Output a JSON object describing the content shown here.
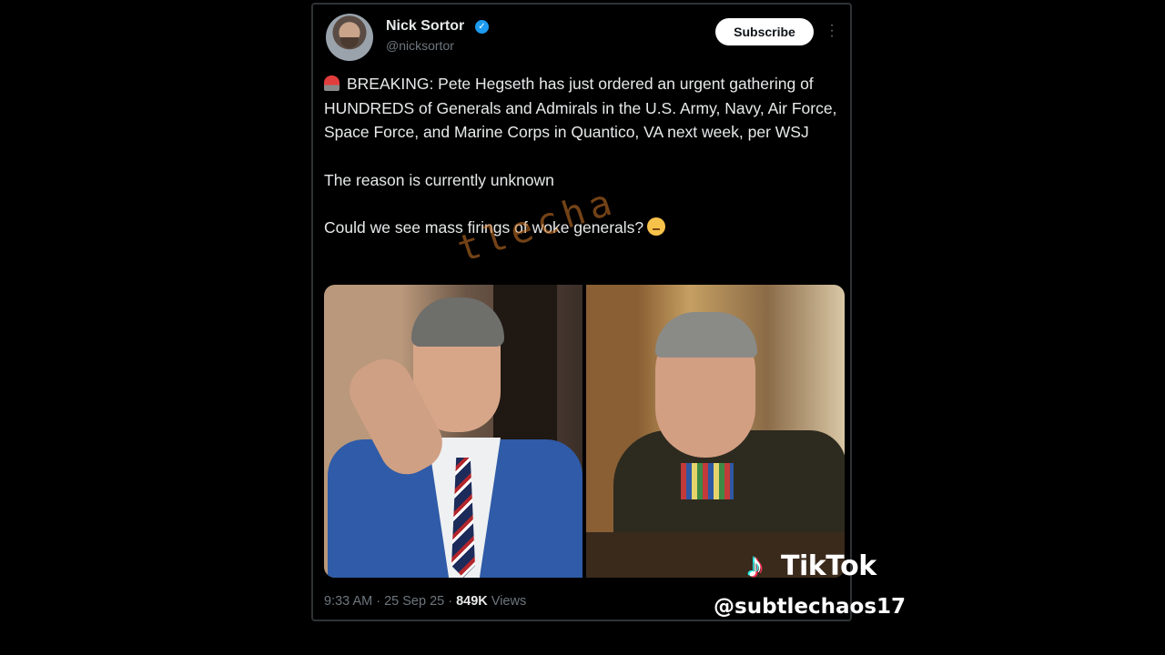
{
  "tweet": {
    "author_name": "Nick Sortor",
    "author_handle": "@nicksortor",
    "subscribe_label": "Subscribe",
    "more_icon": "more-vertical-icon",
    "paragraphs": [
      "BREAKING: Pete Hegseth has just ordered an urgent gathering of HUNDREDS of Generals and Admirals in the U.S. Army, Navy, Air Force, Space Force, and Marine Corps in Quantico, VA next week, per WSJ",
      "The reason is currently unknown",
      "Could we see mass firings of woke generals?"
    ],
    "timestamp": "9:33 AM · 25 Sep 25 ·",
    "views_count": "849K",
    "views_label": "Views"
  },
  "watermark": {
    "brand": "TikTok",
    "handle": "@subtlechaos17",
    "overlay_text": "tlecha"
  },
  "colors": {
    "verified_blue": "#1d9bf0",
    "muted_text": "#6e767d"
  }
}
